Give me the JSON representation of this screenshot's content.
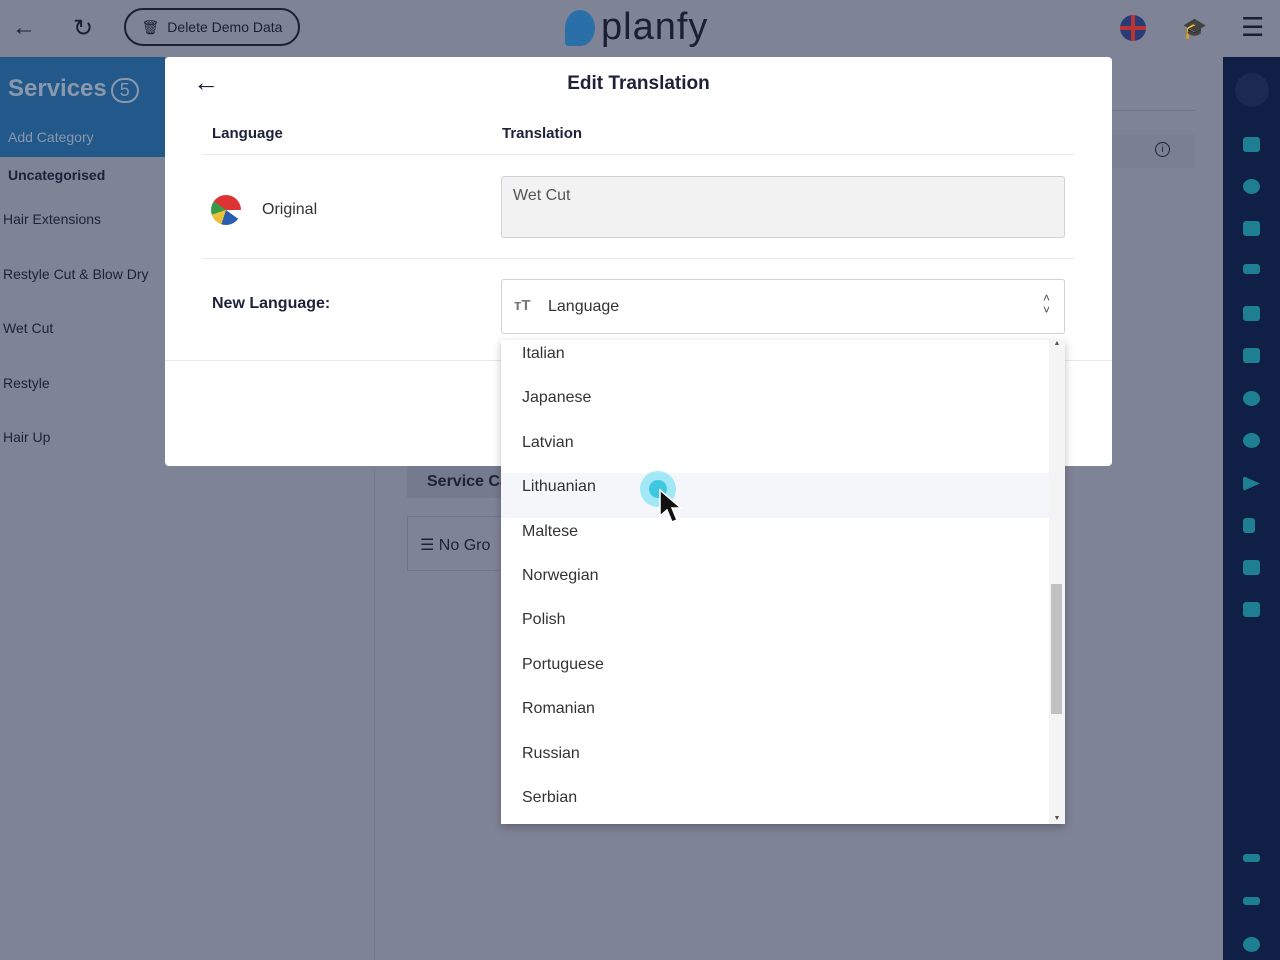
{
  "topbar": {
    "delete_demo": "Delete Demo Data",
    "logo": "planfy"
  },
  "left": {
    "title": "Services",
    "count": "5",
    "add_category": "Add Category",
    "categories": [
      "Uncategorised",
      "Hair Extensions",
      "Restyle Cut & Blow Dry",
      "Wet Cut",
      "Restyle",
      "Hair Up"
    ]
  },
  "background": {
    "tab": "Service Ca",
    "filter": "No Gro"
  },
  "modal": {
    "title": "Edit Translation",
    "col_language": "Language",
    "col_translation": "Translation",
    "original_label": "Original",
    "original_value": "Wet Cut",
    "new_language_label": "New Language:",
    "select_placeholder": "Language"
  },
  "dropdown": {
    "options": [
      "Italian",
      "Japanese",
      "Latvian",
      "Lithuanian",
      "Maltese",
      "Norwegian",
      "Polish",
      "Portuguese",
      "Romanian",
      "Russian",
      "Serbian"
    ],
    "hovered": "Lithuanian"
  },
  "nav_icons": [
    "calendar-check-icon",
    "clock-icon",
    "list-icon",
    "people-icon",
    "contact-icon",
    "cart-icon",
    "gear-icon",
    "globe-icon",
    "send-icon",
    "chart-icon",
    "wallet-icon",
    "chat-icon",
    "swap-icon",
    "key-icon",
    "power-icon"
  ],
  "colors": {
    "nav_bg": "#0f1f45",
    "nav_icon": "#1d7f91",
    "overlay": "#7f8396"
  }
}
